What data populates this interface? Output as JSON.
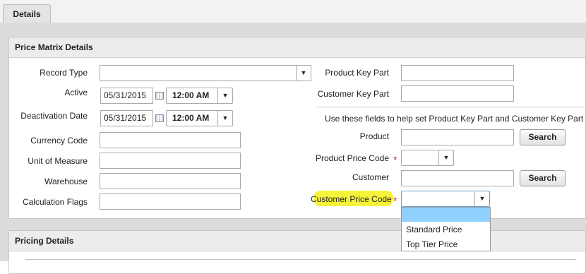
{
  "tabs": [
    {
      "label": "Details"
    }
  ],
  "price_matrix": {
    "title": "Price Matrix Details",
    "record_type": {
      "label": "Record Type",
      "value": ""
    },
    "active": {
      "label": "Active",
      "date": "05/31/2015",
      "time": "12:00 AM"
    },
    "deactivation": {
      "label": "Deactivation Date",
      "date": "05/31/2015",
      "time": "12:00 AM"
    },
    "currency_code": {
      "label": "Currency Code",
      "value": ""
    },
    "unit_of_measure": {
      "label": "Unit of Measure",
      "value": ""
    },
    "warehouse": {
      "label": "Warehouse",
      "value": ""
    },
    "calculation_flags": {
      "label": "Calculation Flags",
      "value": ""
    },
    "product_key_part": {
      "label": "Product Key Part",
      "value": ""
    },
    "customer_key_part": {
      "label": "Customer Key Part",
      "value": ""
    },
    "helper_text": "Use these fields to help set Product Key Part and Customer Key Part",
    "product": {
      "label": "Product",
      "value": "",
      "button": "Search"
    },
    "product_price_code": {
      "label": "Product Price Code",
      "value": ""
    },
    "customer": {
      "label": "Customer",
      "value": "",
      "button": "Search"
    },
    "customer_price_code": {
      "label": "Customer Price Code",
      "value": "",
      "highlight_color": "#f6f33a"
    },
    "required_marker": "*",
    "dropdown_options": [
      "",
      "Standard Price",
      "Top Tier Price"
    ]
  },
  "pricing_details": {
    "title": "Pricing Details"
  },
  "colors": {
    "required": "#cc2a2a",
    "dropdown_selected": "#8fd0ff",
    "highlight": "#f6f33a"
  }
}
